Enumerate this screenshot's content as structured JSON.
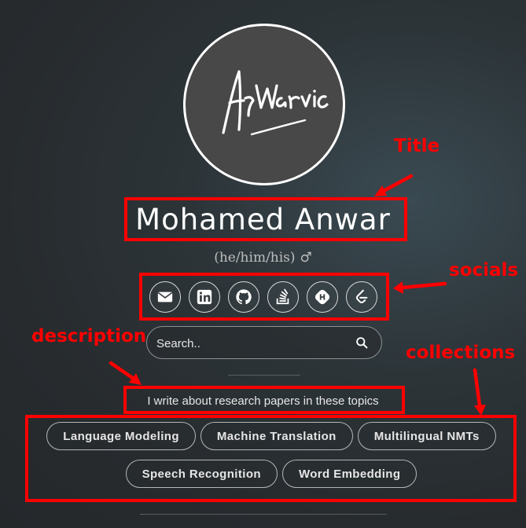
{
  "profile": {
    "avatar_signature": "ArWarvic",
    "name": "Mohamed Anwar",
    "pronouns": "(he/him/his)",
    "gender_symbol": "♂"
  },
  "socials": [
    {
      "icon": "email-icon"
    },
    {
      "icon": "linkedin-icon"
    },
    {
      "icon": "github-icon"
    },
    {
      "icon": "stackoverflow-icon"
    },
    {
      "icon": "hashnode-icon"
    },
    {
      "icon": "leetcode-icon"
    }
  ],
  "search": {
    "placeholder": "Search.."
  },
  "description": "I write about research papers in these topics",
  "collections": [
    "Language Modeling",
    "Machine Translation",
    "Multilingual NMTs",
    "Speech Recognition",
    "Word Embedding"
  ],
  "annotations": {
    "title": "Title",
    "socials": "socials",
    "description": "description",
    "collections": "collections",
    "color": "#ff0000"
  }
}
